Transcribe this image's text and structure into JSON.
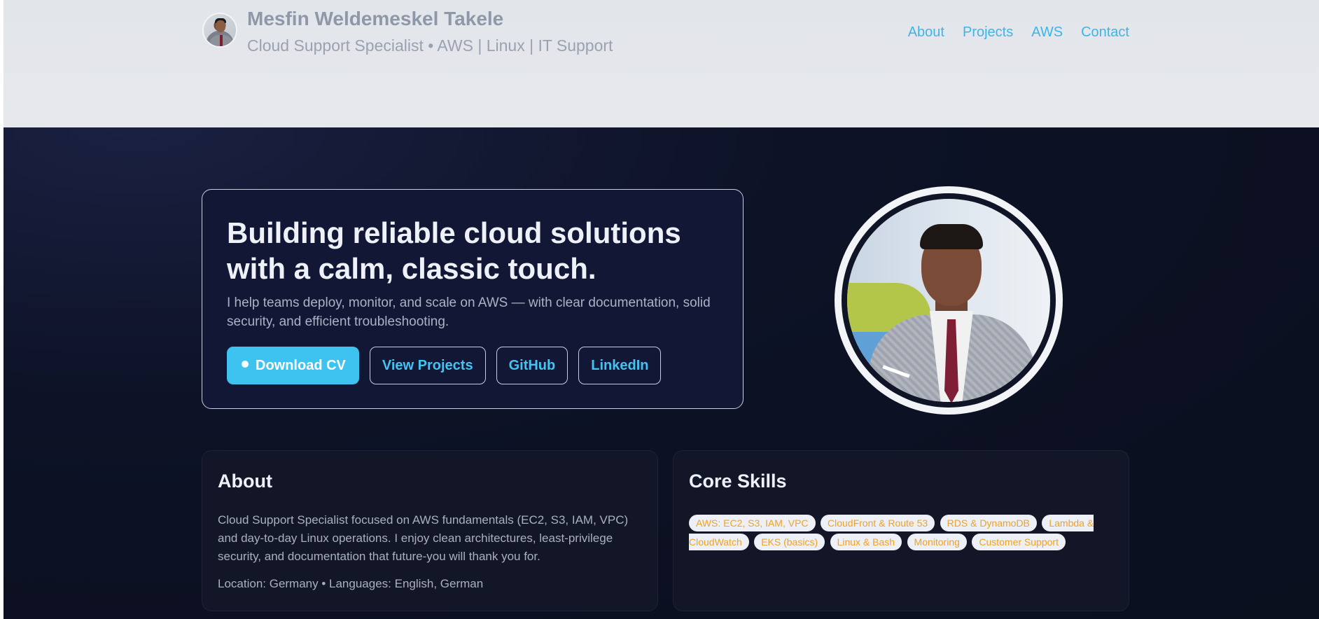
{
  "header": {
    "name": "Mesfin Weldemeskel Takele",
    "tagline": "Cloud Support Specialist • AWS | Linux | IT Support",
    "nav": [
      "About",
      "Projects",
      "AWS",
      "Contact"
    ]
  },
  "hero": {
    "title_line1": "Building reliable cloud solutions",
    "title_line2": "with a calm, classic touch.",
    "subtitle": "I help teams deploy, monitor, and scale on AWS — with clear documentation, solid security, and efficient troubleshooting.",
    "buttons": {
      "download_cv": "Download CV",
      "view_projects": "View Projects",
      "github": "GitHub",
      "linkedin": "LinkedIn"
    }
  },
  "about": {
    "title": "About",
    "text": "Cloud Support Specialist focused on AWS fundamentals (EC2, S3, IAM, VPC) and day-to-day Linux operations. I enjoy clean architectures, least-privilege security, and documentation that future-you will thank you for.",
    "meta": "Location: Germany • Languages: English, German"
  },
  "skills": {
    "title": "Core Skills",
    "items": [
      "AWS: EC2, S3, IAM, VPC",
      "CloudFront & Route 53",
      "RDS & DynamoDB",
      "Lambda & CloudWatch",
      "EKS (basics)",
      "Linux & Bash",
      "Monitoring",
      "Customer Support"
    ]
  },
  "colors": {
    "accent": "#3ec3f0",
    "nav_link": "#3cb6e6",
    "chip_text": "#f0a224",
    "background": "#0b1020"
  },
  "icons": {
    "download": "dot-icon"
  }
}
